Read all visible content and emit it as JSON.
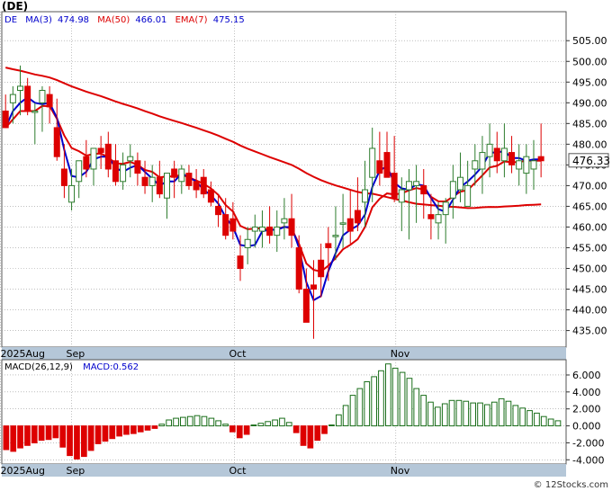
{
  "title": "(DE)",
  "legend": {
    "ticker": "DE",
    "ma3": "MA(3)",
    "ma3_value": "474.98",
    "ma50": "MA(50)",
    "ma50_value": "466.01",
    "ema7": "EMA(7)",
    "ema7_value": "475.15"
  },
  "last_price_label": "476.33",
  "watermark": "© 12Stocks.com",
  "colors": {
    "up": "#2e7d2e",
    "down": "#dd0000",
    "ma3": "#0000cc",
    "ma50": "#dd0000",
    "ema7": "#dd0000",
    "macd": "#1a6e1a",
    "grid": "#999999",
    "axis_band": "#b5c7d8",
    "frame": "#555555"
  },
  "chart_data": [
    {
      "type": "candlestick",
      "title": "(DE)",
      "ylim": [
        431,
        512
      ],
      "y_ticks": [
        "435.00",
        "440.00",
        "445.00",
        "450.00",
        "455.00",
        "460.00",
        "465.00",
        "470.00",
        "475.00",
        "480.00",
        "485.00",
        "490.00",
        "495.00",
        "500.00",
        "505.00"
      ],
      "x_labels": [
        {
          "label": "2025Aug",
          "index": -0.7
        },
        {
          "label": "Sep",
          "index": 9
        },
        {
          "label": "Oct",
          "index": 31.2
        },
        {
          "label": "Nov",
          "index": 53.2
        }
      ],
      "grid": true,
      "open": [
        488,
        490,
        493,
        494,
        488,
        490,
        492,
        484,
        474,
        466,
        471,
        477,
        474,
        479,
        480,
        476,
        471,
        476,
        476,
        472,
        470,
        472,
        467,
        474,
        471,
        473,
        471,
        472,
        469,
        465,
        463,
        462,
        453,
        455,
        459,
        459,
        460,
        458,
        461,
        462,
        455,
        445,
        446,
        452,
        456,
        458,
        461,
        462,
        464,
        466,
        472,
        476,
        478,
        473,
        466,
        469,
        470,
        470,
        463,
        461,
        463,
        467,
        469,
        465,
        474,
        474,
        477,
        479,
        476,
        478,
        474,
        473,
        474,
        477
      ],
      "high": [
        492,
        494,
        499,
        496,
        490,
        494,
        494,
        491,
        480,
        474,
        476,
        481,
        479,
        482,
        483,
        480,
        478,
        480,
        478,
        476,
        475,
        476,
        472,
        476,
        475,
        475,
        474,
        474,
        471,
        468,
        467,
        466,
        458,
        460,
        463,
        464,
        465,
        464,
        467,
        468,
        458,
        450,
        452,
        456,
        460,
        465,
        468,
        469,
        472,
        476,
        484,
        483,
        483,
        482,
        472,
        474,
        475,
        474,
        468,
        466,
        467,
        475,
        478,
        476,
        480,
        482,
        485,
        483,
        485,
        482,
        480,
        480,
        481,
        485
      ],
      "low": [
        484,
        485,
        487,
        487,
        480,
        483,
        485,
        476,
        467,
        464,
        467,
        472,
        470,
        474,
        472,
        470,
        469,
        472,
        470,
        468,
        466,
        467,
        462,
        467,
        468,
        469,
        467,
        467,
        465,
        460,
        457,
        457,
        447,
        451,
        455,
        455,
        456,
        454,
        457,
        455,
        444,
        437,
        433,
        443,
        447,
        452,
        455,
        456,
        459,
        460,
        466,
        470,
        472,
        466,
        459,
        457,
        461,
        462,
        457,
        457,
        456,
        462,
        466,
        465,
        470,
        468,
        472,
        473,
        472,
        473,
        470,
        468,
        469,
        472
      ],
      "close": [
        484,
        492,
        494,
        488,
        488,
        493,
        489,
        477,
        470,
        470,
        476,
        474,
        479,
        478,
        474,
        471,
        475,
        477,
        473,
        470,
        472,
        468,
        473,
        472,
        474,
        470,
        469,
        468,
        466,
        463,
        458,
        459,
        450,
        457,
        460,
        460,
        458,
        460,
        462,
        458,
        445,
        437,
        445,
        448,
        455,
        458,
        461,
        459,
        461,
        469,
        479,
        473,
        472,
        467,
        469,
        471,
        471,
        468,
        462,
        463,
        466,
        471,
        472,
        470,
        476,
        478,
        480,
        476,
        479,
        475,
        476,
        477,
        476,
        476
      ]
    },
    {
      "type": "bar",
      "title": "MACD(26,12,9)",
      "series": [
        {
          "name": "MACD",
          "legend_value": "0.562"
        }
      ],
      "ylim": [
        -4.5,
        7.8
      ],
      "y_ticks": [
        "6.000",
        "4.000",
        "2.000",
        "0.000",
        "-2.000",
        "-4.000"
      ],
      "values": [
        -2.8,
        -3.0,
        -2.6,
        -2.3,
        -2.0,
        -1.7,
        -1.6,
        -1.4,
        -2.5,
        -3.5,
        -3.9,
        -3.6,
        -2.9,
        -2.1,
        -1.8,
        -1.5,
        -1.2,
        -1.0,
        -0.9,
        -0.7,
        -0.5,
        -0.3,
        0.2,
        0.7,
        0.9,
        1.0,
        1.1,
        1.2,
        1.1,
        0.9,
        0.6,
        0.2,
        -0.7,
        -1.4,
        -1.0,
        0.1,
        0.3,
        0.5,
        0.7,
        0.9,
        0.4,
        -0.8,
        -2.3,
        -2.6,
        -1.7,
        -0.9,
        0.1,
        1.3,
        2.4,
        3.6,
        4.4,
        5.2,
        5.8,
        6.5,
        7.3,
        6.8,
        6.3,
        5.6,
        4.4,
        3.6,
        2.8,
        2.2,
        2.6,
        3.0,
        3.0,
        2.9,
        2.7,
        2.7,
        2.5,
        2.8,
        3.2,
        2.9,
        2.4,
        2.1,
        1.8,
        1.5,
        1.1,
        0.8,
        0.6
      ]
    }
  ]
}
